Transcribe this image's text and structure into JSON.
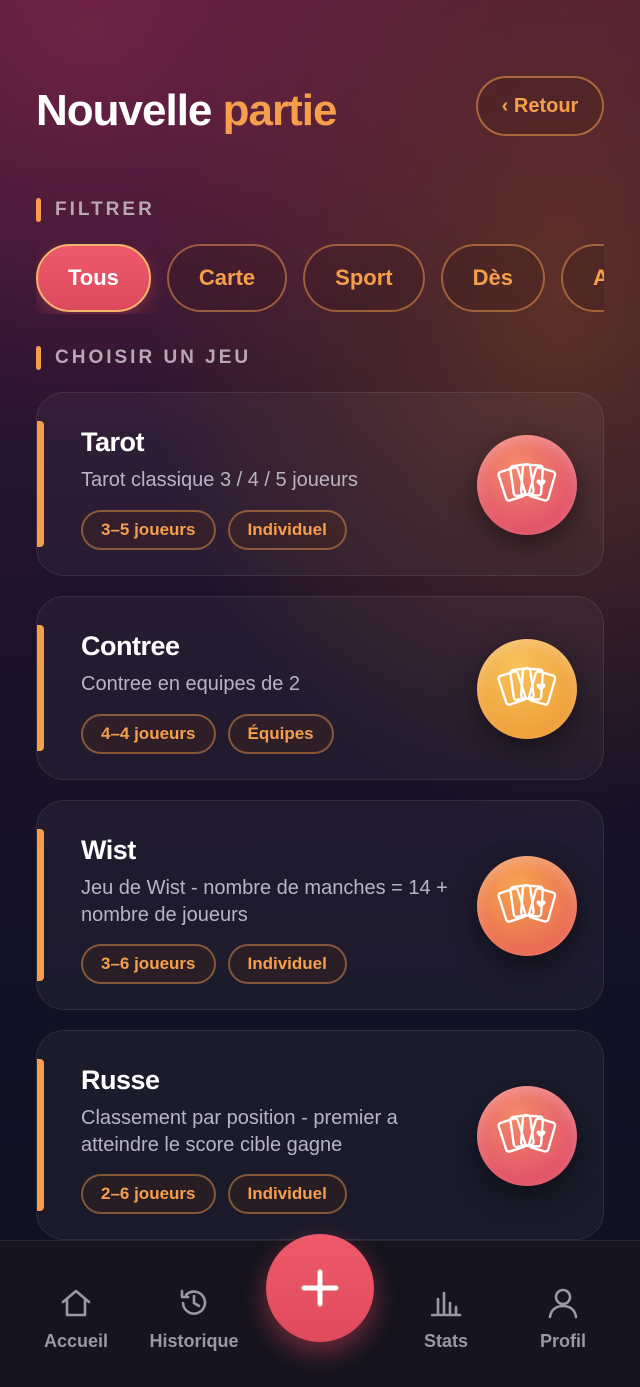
{
  "header": {
    "title_part1": "Nouvelle",
    "title_part2": "partie",
    "back_label": "‹ Retour"
  },
  "filter_section": {
    "label": "FILTRER",
    "chips": [
      "Tous",
      "Carte",
      "Sport",
      "Dès",
      "Ad"
    ],
    "active": "Tous"
  },
  "games_section": {
    "label": "CHOISIR UN JEU",
    "games": [
      {
        "name": "Tarot",
        "description": "Tarot classique 3 / 4 / 5 joueurs",
        "tags": [
          "3–5 joueurs",
          "Individuel"
        ],
        "icon": "playing-cards-icon"
      },
      {
        "name": "Contree",
        "description": "Contree en equipes de 2",
        "tags": [
          "4–4 joueurs",
          "Équipes"
        ],
        "icon": "playing-cards-icon"
      },
      {
        "name": "Wist",
        "description": "Jeu de Wist - nombre de manches = 14 + nombre de joueurs",
        "tags": [
          "3–6 joueurs",
          "Individuel"
        ],
        "icon": "playing-cards-icon"
      },
      {
        "name": "Russe",
        "description": "Classement par position - premier a atteindre le score cible gagne",
        "tags": [
          "2–6 joueurs",
          "Individuel"
        ],
        "icon": "playing-cards-icon"
      }
    ]
  },
  "nav": {
    "items": [
      {
        "label": "Accueil",
        "icon": "home-icon"
      },
      {
        "label": "Historique",
        "icon": "history-icon"
      },
      {
        "label": "Stats",
        "icon": "stats-icon"
      },
      {
        "label": "Profil",
        "icon": "profile-icon"
      }
    ],
    "fab_icon": "plus-icon"
  },
  "colors": {
    "accent": "#f59e4b",
    "primary": "#e8536a"
  }
}
